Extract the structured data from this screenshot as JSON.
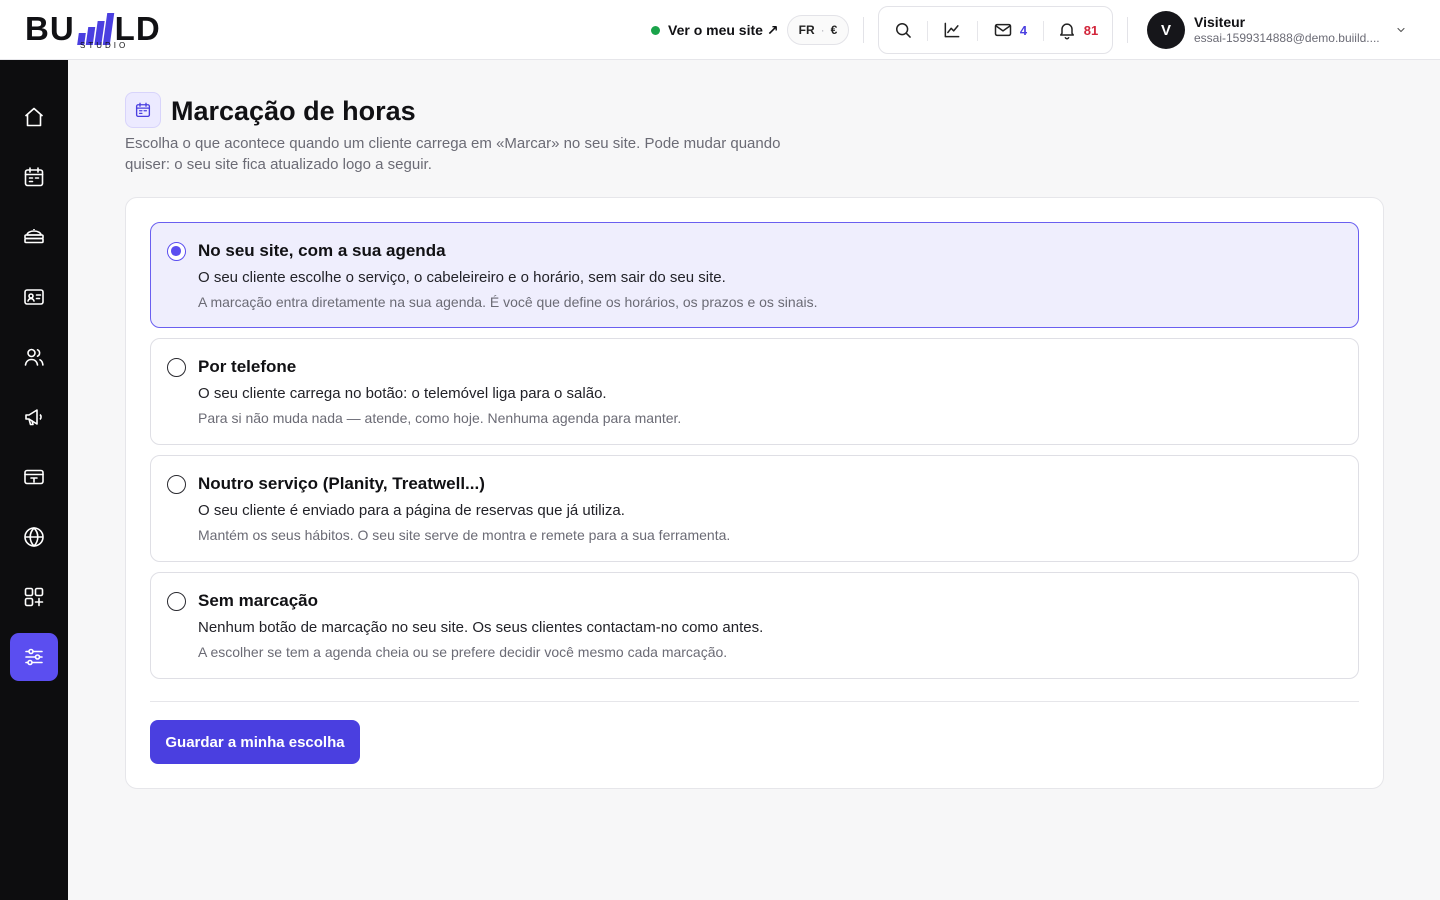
{
  "brand": {
    "logo_left": "BU",
    "logo_right": "LD",
    "logo_sub": "STUDIO"
  },
  "header": {
    "view_site": "Ver o meu site ↗",
    "locale_lang": "FR",
    "locale_sep": "·",
    "locale_currency": "€",
    "messages_count": "4",
    "notifications_count": "81",
    "user": {
      "initial": "V",
      "name": "Visiteur",
      "email": "essai-1599314888@demo.buiild...."
    },
    "icons": [
      "search-icon",
      "chart-icon",
      "mail-icon",
      "bell-icon",
      "chevron-down-icon"
    ]
  },
  "sidebar": {
    "items": [
      {
        "icon": "home-icon"
      },
      {
        "icon": "calendar-icon"
      },
      {
        "icon": "service-tray-icon"
      },
      {
        "icon": "contact-card-icon"
      },
      {
        "icon": "users-icon"
      },
      {
        "icon": "megaphone-icon"
      },
      {
        "icon": "payment-card-icon"
      },
      {
        "icon": "globe-icon"
      },
      {
        "icon": "apps-add-icon"
      },
      {
        "icon": "settings-sliders-icon",
        "active": true
      }
    ]
  },
  "page": {
    "icon": "calendar-icon",
    "title": "Marcação de horas",
    "description": "Escolha o que acontece quando um cliente carrega em «Marcar» no seu site. Pode mudar quando quiser: o seu site fica atualizado logo a seguir."
  },
  "options": [
    {
      "title": "No seu site, com a sua agenda",
      "description": "O seu cliente escolhe o serviço, o cabeleireiro e o horário, sem sair do seu site.",
      "note": "A marcação entra diretamente na sua agenda. É você que define os horários, os prazos e os sinais.",
      "selected": true
    },
    {
      "title": "Por telefone",
      "description": "O seu cliente carrega no botão: o telemóvel liga para o salão.",
      "note": "Para si não muda nada — atende, como hoje. Nenhuma agenda para manter.",
      "selected": false
    },
    {
      "title": "Noutro serviço (Planity, Treatwell...)",
      "description": "O seu cliente é enviado para a página de reservas que já utiliza.",
      "note": "Mantém os seus hábitos. O seu site serve de montra e remete para a sua ferramenta.",
      "selected": false
    },
    {
      "title": "Sem marcação",
      "description": "Nenhum botão de marcação no seu site. Os seus clientes contactam-no como antes.",
      "note": "A escolher se tem a agenda cheia ou se prefere decidir você mesmo cada marcação.",
      "selected": false
    }
  ],
  "actions": {
    "save_label": "Guardar a minha escolha"
  },
  "colors": {
    "accent": "#4a3fe0",
    "accent_light": "#efeefd",
    "sidebar_bg": "#0d0d0f",
    "status_green": "#1aa34a",
    "badge_red": "#d2253a"
  }
}
